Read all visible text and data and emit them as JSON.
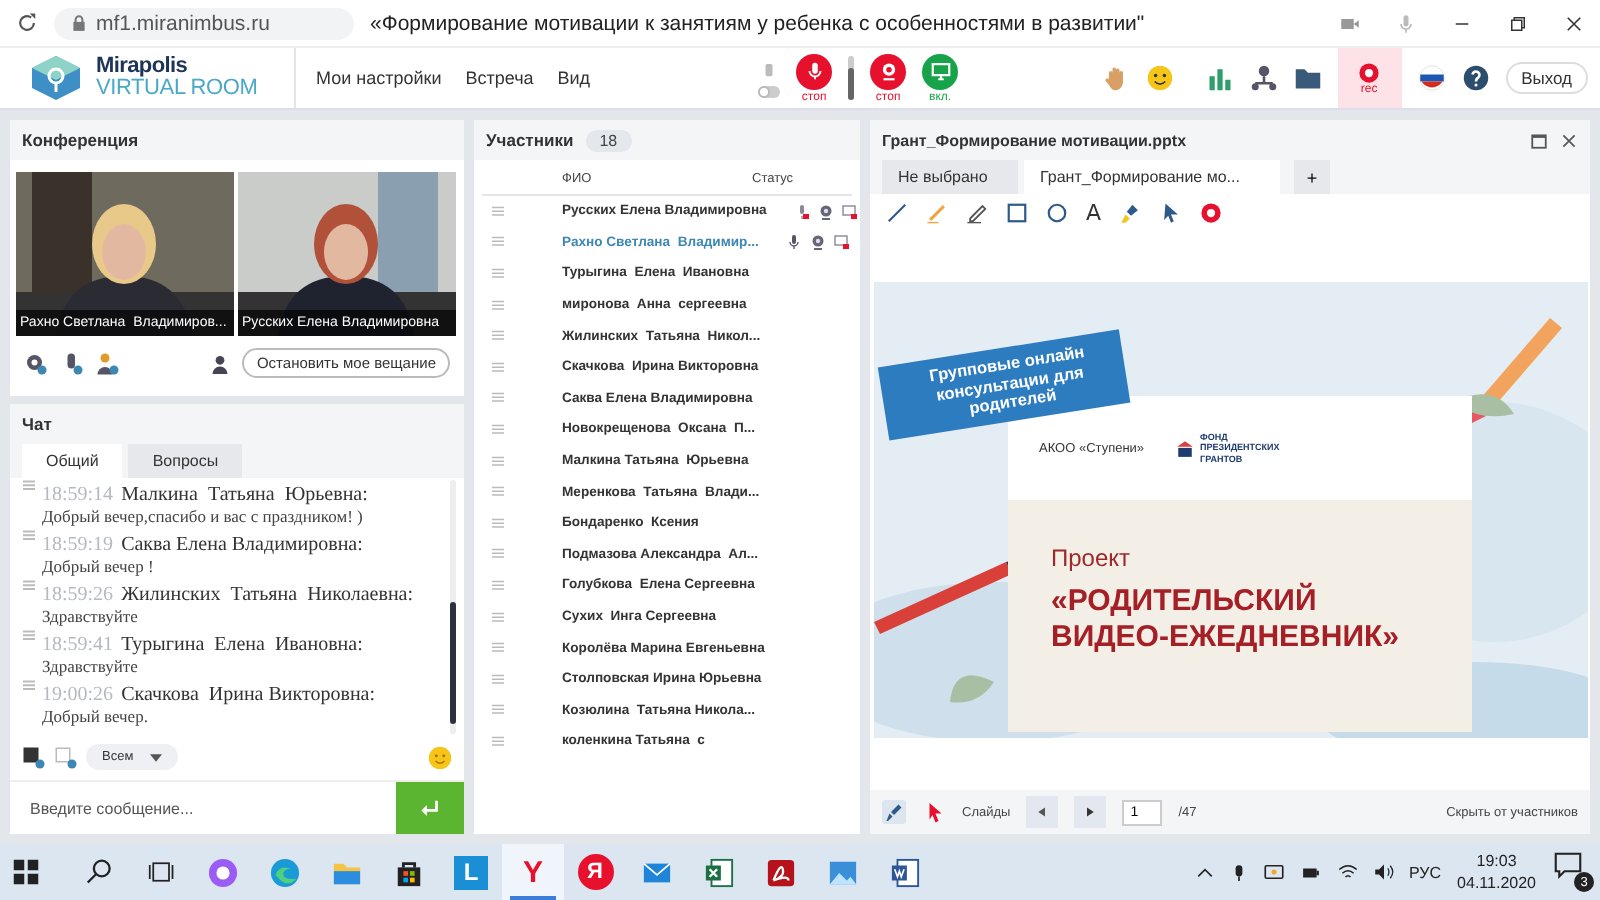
{
  "browser": {
    "url": "mf1.miranimbus.ru",
    "title": "«Формирование мотивации к занятиям у ребенка с особенностями в развитии\""
  },
  "app": {
    "logo_top": "Mirapolis",
    "logo_bottom": "VIRTUAL ROOM",
    "menu": [
      "Мои настройки",
      "Встреча",
      "Вид"
    ],
    "speaker_toggle_on": false,
    "mic_volume": {
      "level": 0.75
    },
    "media": [
      {
        "kind": "mic",
        "label": "стоп",
        "color": "#e8112d"
      },
      {
        "kind": "camera",
        "label": "стоп",
        "color": "#e8112d"
      },
      {
        "kind": "screen",
        "label": "вкл.",
        "color": "#16a34a"
      }
    ],
    "record": {
      "label": "rec",
      "on": true
    },
    "exit": "Выход"
  },
  "conference": {
    "title": "Конференция",
    "videos": [
      {
        "kind": "picture",
        "caption": "Рахно Светлана  Владимиров..."
      },
      {
        "kind": "picture",
        "caption": "Русских Елена Владимировна"
      }
    ],
    "stop_button": "Остановить мое вещание"
  },
  "chat": {
    "title": "Чат",
    "tabs": [
      {
        "label": "Общий",
        "selected": true
      },
      {
        "label": "Вопросы",
        "selected": false
      }
    ],
    "messages": [
      {
        "time": "18:59:14",
        "author": "Малкина  Татьяна  Юрьевна:",
        "text": "Добрый вечер,спасибо и вас с праздником! )"
      },
      {
        "time": "18:59:19",
        "author": "Саква Елена Владимировна:",
        "text": "Добрый вечер !"
      },
      {
        "time": "18:59:26",
        "author": "Жилинских  Татьяна  Николаевна:",
        "text": "Здравствуйте"
      },
      {
        "time": "18:59:41",
        "author": "Турыгина  Елена  Ивановна:",
        "text": "Здравствуйте"
      },
      {
        "time": "19:00:26",
        "author": "Скачкова  Ирина Викторовна:",
        "text": "Добрый вечер."
      }
    ],
    "recipient": "Всем",
    "input": {
      "placeholder": "Введите сообщение..."
    }
  },
  "participants": {
    "title": "Участники",
    "count": "18",
    "columns": [
      "ФИО",
      "Статус"
    ],
    "rows": [
      {
        "name": "Русских Елена Владимировна",
        "selected": false,
        "status": {
          "mic_on": false,
          "camera_on": true,
          "screen_on": false
        }
      },
      {
        "name": "Рахно Светлана  Владимир...",
        "selected": true,
        "status": {
          "mic_on": true,
          "camera_on": true,
          "screen_on": false
        }
      },
      {
        "name": "Турыгина  Елена  Ивановна",
        "selected": false
      },
      {
        "name": "миронова  Анна  сергеевна",
        "selected": false
      },
      {
        "name": "Жилинских  Татьяна  Никол...",
        "selected": false
      },
      {
        "name": "Скачкова  Ирина Викторовна",
        "selected": false
      },
      {
        "name": "Саква Елена Владимировна",
        "selected": false
      },
      {
        "name": "Новокрещенова  Оксана  П...",
        "selected": false
      },
      {
        "name": "Малкина Татьяна  Юрьевна",
        "selected": false
      },
      {
        "name": "Меренкова  Татьяна  Влади...",
        "selected": false
      },
      {
        "name": "Бондаренко  Ксения",
        "selected": false
      },
      {
        "name": "Подмазова Александра  Ал...",
        "selected": false
      },
      {
        "name": "Голубкова  Елена Сергеевна",
        "selected": false
      },
      {
        "name": "Сухих  Инга Сергеевна",
        "selected": false
      },
      {
        "name": "Королёва Марина Евгеньевна",
        "selected": false
      },
      {
        "name": "Столповская Ирина Юрьевна",
        "selected": false
      },
      {
        "name": "Козюлина  Татьяна Никола...",
        "selected": false
      },
      {
        "name": "коленкина Татьяна  с",
        "selected": false
      }
    ]
  },
  "presentation": {
    "title": "Грант_Формирование мотивации.pptx",
    "tabs": [
      {
        "label": "Не выбрано",
        "selected": false
      },
      {
        "label": "Грант_Формирование мо...",
        "selected": true
      }
    ],
    "add_tab": "+",
    "tools": [
      {
        "kind": "line"
      },
      {
        "kind": "marker"
      },
      {
        "kind": "pen"
      },
      {
        "kind": "rect"
      },
      {
        "kind": "circle"
      },
      {
        "kind": "text",
        "glyph": "A"
      },
      {
        "kind": "fill"
      },
      {
        "kind": "pointer"
      },
      {
        "kind": "clear"
      }
    ],
    "slide": {
      "banner": "Групповые онлайн консультации для родителей",
      "org": "АКОО «Ступени»",
      "fund": "ФОНД ПРЕЗИДЕНТСКИХ ГРАНТОВ",
      "project": "Проект",
      "name": "«РОДИТЕЛЬСКИЙ ВИДЕО-ЕЖЕДНЕВНИК»"
    },
    "pager": {
      "label": "Слайды",
      "page": "1",
      "total": "/47",
      "hide": "Скрыть от участников"
    }
  },
  "taskbar": {
    "apps": [
      {
        "kind": "alice",
        "selected": false
      },
      {
        "kind": "edge",
        "selected": false
      },
      {
        "kind": "folder",
        "selected": false
      },
      {
        "kind": "store",
        "selected": false
      },
      {
        "kind": "tile",
        "glyph": "L",
        "color": "#1b8fd6",
        "selected": false
      },
      {
        "kind": "yabrowser",
        "glyph": "Y",
        "selected": true
      },
      {
        "kind": "yandex",
        "glyph": "Я",
        "selected": false
      },
      {
        "kind": "mail",
        "selected": false
      },
      {
        "kind": "excel",
        "selected": false
      },
      {
        "kind": "pdf",
        "selected": false
      },
      {
        "kind": "photos",
        "selected": false
      },
      {
        "kind": "word",
        "selected": false
      }
    ],
    "lang": "РУС",
    "time": "19:03",
    "date": "04.11.2020",
    "notifications": "3"
  }
}
